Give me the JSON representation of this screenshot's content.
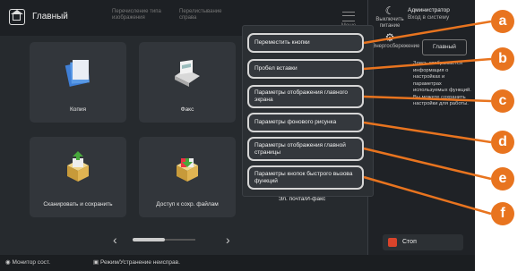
{
  "app": {
    "title": "Главный"
  },
  "topbar": {
    "item1": "Перечисление типа изображения",
    "item2": "Перелистывание справа",
    "menu_label": "Меню"
  },
  "tiles": [
    {
      "label": "Копия",
      "icon": "copy-icon"
    },
    {
      "label": "Факс",
      "icon": "fax-icon"
    },
    {
      "label": "Сканировать и сохранить",
      "icon": "scan-save-icon"
    },
    {
      "label": "Доступ к сохр. файлам",
      "icon": "access-files-icon"
    },
    {
      "label": "Эл. почта/И-факс",
      "icon": "email-ifax-icon"
    }
  ],
  "pager": {
    "prev": "‹",
    "next": "›"
  },
  "bottombar": {
    "monitor": "Монитор сост.",
    "reset": "Режим/Устранение неисправ."
  },
  "right_panel": {
    "icon1": "Выключить питание",
    "icon2": "Энергосбережение",
    "admin": "Администратор",
    "admin_sub": "Вход в систему",
    "home_btn": "Главный",
    "description": "Здесь отображается информация о настройках и параметрах используемых функций. Вы можете сохранить настройки для работы."
  },
  "stop": {
    "label": "Стоп"
  },
  "popup_buttons": [
    {
      "label": "Переместить кнопки",
      "callout": "a"
    },
    {
      "label": "Пробел вставки",
      "callout": "b"
    },
    {
      "label": "Параметры отображения главного экрана",
      "callout": "c"
    },
    {
      "label": "Параметры фонового рисунка",
      "callout": "d"
    },
    {
      "label": "Параметры отображения главной страницы",
      "callout": "e"
    },
    {
      "label": "Параметры кнопок быстрого вызова функций",
      "callout": "f"
    }
  ],
  "colors": {
    "accent": "#e8741f",
    "stop": "#d9442b",
    "screen_bg": "#262a2e"
  }
}
